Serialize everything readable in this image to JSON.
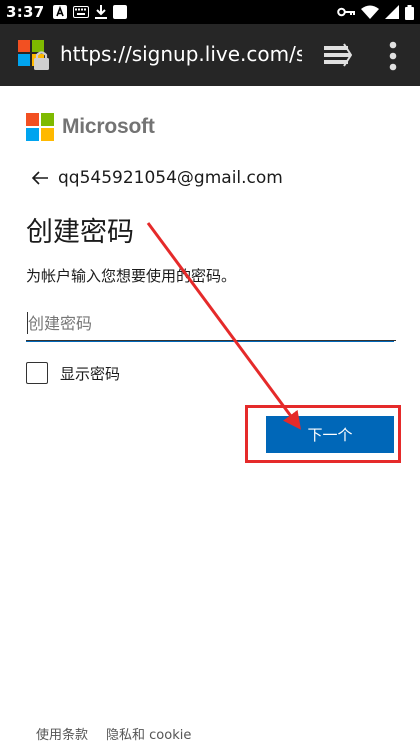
{
  "status_bar": {
    "time": "3:37"
  },
  "browser": {
    "url": "https://signup.live.com/si"
  },
  "brand": {
    "name": "Microsoft",
    "colors": [
      "#f25022",
      "#7fba00",
      "#00a4ef",
      "#ffb900"
    ]
  },
  "identity": {
    "email": "qq545921054@gmail.com"
  },
  "page": {
    "title": "创建密码",
    "description": "为帐户输入您想要使用的密码。"
  },
  "password_field": {
    "value": "",
    "placeholder": "创建密码"
  },
  "show_password": {
    "label": "显示密码",
    "checked": false
  },
  "actions": {
    "next_label": "下一个"
  },
  "footer": {
    "terms_label": "使用条款",
    "privacy_label": "隐私和 cookie"
  },
  "accent_color": "#0067b8",
  "annotation_color": "#e52a2a"
}
